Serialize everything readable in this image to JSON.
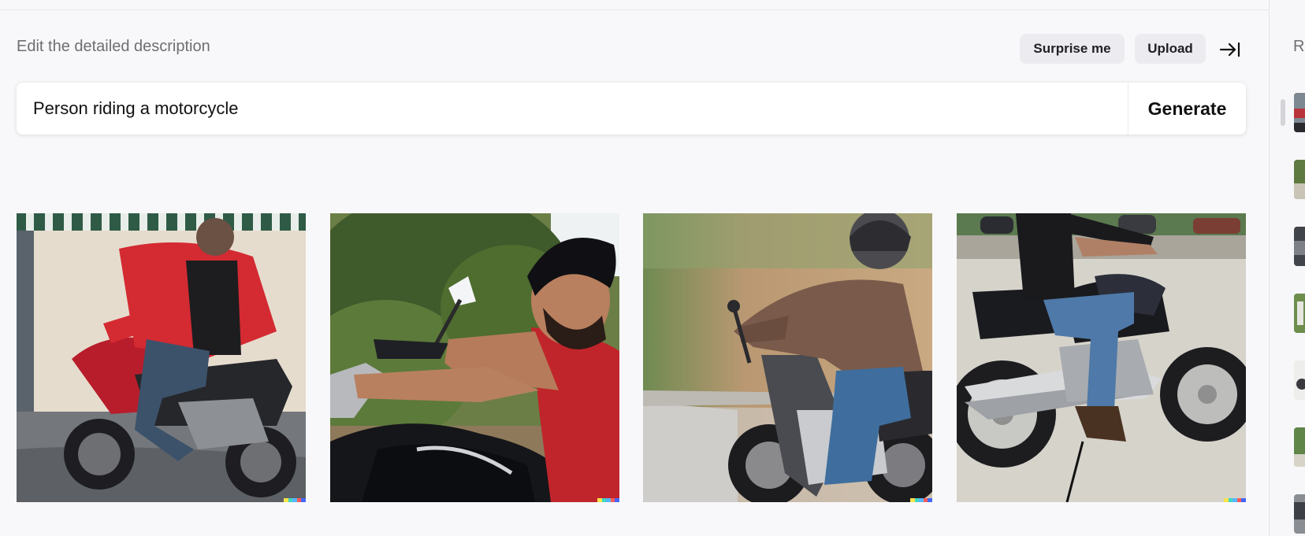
{
  "header": {
    "title": "Edit the detailed description",
    "surprise_label": "Surprise me",
    "upload_label": "Upload"
  },
  "prompt": {
    "value": "Person riding a motorcycle",
    "generate_label": "Generate"
  },
  "results": [
    {
      "icon": "image-red-jacket-rider"
    },
    {
      "icon": "image-man-on-black-motorcycle"
    },
    {
      "icon": "image-helmet-rider-motion-blur"
    },
    {
      "icon": "image-cruiser-motorcycle-rider"
    }
  ],
  "sidebar": {
    "title": "R",
    "thumbnails": 7
  },
  "colors": {
    "background": "#f8f8fa",
    "button_bg": "#ececf0",
    "muted_text": "#6e6e73"
  }
}
